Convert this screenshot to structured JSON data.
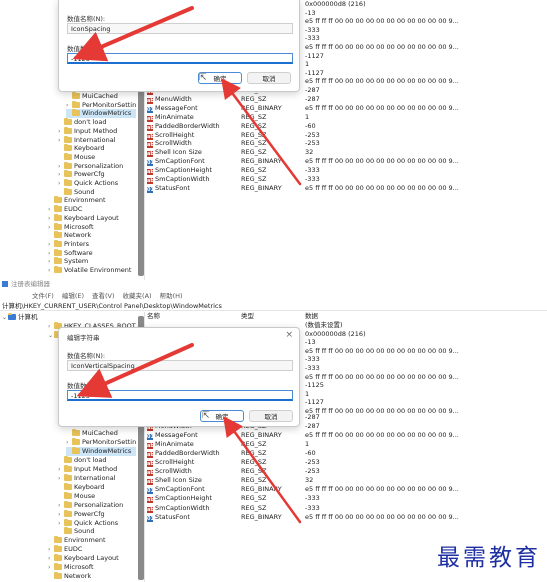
{
  "top": {
    "dialog": {
      "value_name_label": "数值名称(N):",
      "value_name": "IconSpacing",
      "value_data_label": "数值数据(V):",
      "value_data": "-1125",
      "ok": "确定",
      "cancel": "取消"
    },
    "tree": [
      {
        "label": "MuiCached",
        "indent": 1,
        "expand": ""
      },
      {
        "label": "PerMonitorSettin",
        "indent": 1,
        "expand": ">"
      },
      {
        "label": "WindowMetrics",
        "indent": 1,
        "expand": "",
        "selected": true
      },
      {
        "label": "don't load",
        "indent": 0,
        "expand": ""
      },
      {
        "label": "Input Method",
        "indent": 0,
        "expand": ">"
      },
      {
        "label": "International",
        "indent": 0,
        "expand": ">"
      },
      {
        "label": "Keyboard",
        "indent": 0,
        "expand": ""
      },
      {
        "label": "Mouse",
        "indent": 0,
        "expand": ""
      },
      {
        "label": "Personalization",
        "indent": 0,
        "expand": ">"
      },
      {
        "label": "PowerCfg",
        "indent": 0,
        "expand": ">"
      },
      {
        "label": "Quick Actions",
        "indent": 0,
        "expand": ">"
      },
      {
        "label": "Sound",
        "indent": 0,
        "expand": ""
      },
      {
        "label": "Environment",
        "indent": -1,
        "expand": ""
      },
      {
        "label": "EUDC",
        "indent": -1,
        "expand": ">"
      },
      {
        "label": "Keyboard Layout",
        "indent": -1,
        "expand": ">"
      },
      {
        "label": "Microsoft",
        "indent": -1,
        "expand": ">"
      },
      {
        "label": "Network",
        "indent": -1,
        "expand": ""
      },
      {
        "label": "Printers",
        "indent": -1,
        "expand": ">"
      },
      {
        "label": "Software",
        "indent": -1,
        "expand": ">"
      },
      {
        "label": "System",
        "indent": -1,
        "expand": ">"
      },
      {
        "label": "Volatile Environment",
        "indent": -1,
        "expand": ">"
      }
    ],
    "data_col_top": [
      "0x000000d8 (216)",
      "-13",
      "e5 ff ff ff 00 00 00 00 00 00 00 00 00 00 00 9...",
      "-333",
      "-333",
      "e5 ff ff ff 00 00 00 00 00 00 00 00 00 00 00 9...",
      "-1127",
      "1",
      "-1127",
      "e5 ff ff ff 00 00 00 00 00 00 00 00 00 00 00 9..."
    ],
    "rows": [
      {
        "name": "",
        "type": "REG_SZ",
        "data": "-287",
        "icon": "sz"
      },
      {
        "name": "MenuWidth",
        "type": "REG_SZ",
        "data": "-287",
        "icon": "sz"
      },
      {
        "name": "MessageFont",
        "type": "REG_BINARY",
        "data": "e5 ff ff ff 00 00 00 00 00 00 00 00 00 00 00 9...",
        "icon": "bin"
      },
      {
        "name": "MinAnimate",
        "type": "REG_SZ",
        "data": "1",
        "icon": "sz"
      },
      {
        "name": "PaddedBorderWidth",
        "type": "REG_SZ",
        "data": "-60",
        "icon": "sz"
      },
      {
        "name": "ScrollHeight",
        "type": "REG_SZ",
        "data": "-253",
        "icon": "sz"
      },
      {
        "name": "ScrollWidth",
        "type": "REG_SZ",
        "data": "-253",
        "icon": "sz"
      },
      {
        "name": "Shell Icon Size",
        "type": "REG_SZ",
        "data": "32",
        "icon": "sz"
      },
      {
        "name": "SmCaptionFont",
        "type": "REG_BINARY",
        "data": "e5 ff ff ff 00 00 00 00 00 00 00 00 00 00 00 9...",
        "icon": "bin"
      },
      {
        "name": "SmCaptionHeight",
        "type": "REG_SZ",
        "data": "-333",
        "icon": "sz"
      },
      {
        "name": "SmCaptionWidth",
        "type": "REG_SZ",
        "data": "-333",
        "icon": "sz"
      },
      {
        "name": "StatusFont",
        "type": "REG_BINARY",
        "data": "e5 ff ff ff 00 00 00 00 00 00 00 00 00 00 00 9...",
        "icon": "bin"
      }
    ]
  },
  "bottom": {
    "title": "注册表编辑器",
    "menu": [
      "文件(F)",
      "编辑(E)",
      "查看(V)",
      "收藏夹(A)",
      "帮助(H)"
    ],
    "address": "计算机\\HKEY_CURRENT_USER\\Control Panel\\Desktop\\WindowMetrics",
    "headers": {
      "name": "名称",
      "type": "类型",
      "data": "数据"
    },
    "tree_top": [
      {
        "label": "计算机",
        "indent": -2,
        "expand": "v"
      },
      {
        "label": "HKEY_CLASSES_ROOT",
        "indent": -1,
        "expand": ">"
      },
      {
        "label": "H",
        "indent": -1,
        "expand": "v"
      }
    ],
    "dialog": {
      "title": "编辑字符串",
      "close": "×",
      "value_name_label": "数值名称(N):",
      "value_name": "IconVerticalSpacing",
      "value_data_label": "数值数据(V):",
      "value_data": "-1125",
      "ok": "确定",
      "cancel": "取消"
    },
    "data_col_top": [
      "(数值未设置)",
      "0x000000d8 (216)",
      "-13",
      "e5 ff ff ff 00 00 00 00 00 00 00 00 00 00 00 9...",
      "-333",
      "-333",
      "e5 ff ff ff 00 00 00 00 00 00 00 00 00 00 00 9...",
      "-1125",
      "1",
      "-1127",
      "e5 ff ff ff 00 00 00 00 00 00 00 00 00 00 00 9..."
    ],
    "tree": [
      {
        "label": "MuiCached",
        "indent": 1,
        "expand": ""
      },
      {
        "label": "PerMonitorSettin",
        "indent": 1,
        "expand": ">"
      },
      {
        "label": "WindowMetrics",
        "indent": 1,
        "expand": "",
        "selected": true
      },
      {
        "label": "don't load",
        "indent": 0,
        "expand": ""
      },
      {
        "label": "Input Method",
        "indent": 0,
        "expand": ">"
      },
      {
        "label": "International",
        "indent": 0,
        "expand": ">"
      },
      {
        "label": "Keyboard",
        "indent": 0,
        "expand": ""
      },
      {
        "label": "Mouse",
        "indent": 0,
        "expand": ""
      },
      {
        "label": "Personalization",
        "indent": 0,
        "expand": ">"
      },
      {
        "label": "PowerCfg",
        "indent": 0,
        "expand": ">"
      },
      {
        "label": "Quick Actions",
        "indent": 0,
        "expand": ">"
      },
      {
        "label": "Sound",
        "indent": 0,
        "expand": ""
      },
      {
        "label": "Environment",
        "indent": -1,
        "expand": ""
      },
      {
        "label": "EUDC",
        "indent": -1,
        "expand": ">"
      },
      {
        "label": "Keyboard Layout",
        "indent": -1,
        "expand": ">"
      },
      {
        "label": "Microsoft",
        "indent": -1,
        "expand": ">"
      },
      {
        "label": "Network",
        "indent": -1,
        "expand": ""
      }
    ],
    "rows": [
      {
        "name": "",
        "type": "REG_SZ",
        "data": "-287",
        "icon": "sz"
      },
      {
        "name": "MenuWidth",
        "type": "REG_SZ",
        "data": "-287",
        "icon": "sz"
      },
      {
        "name": "MessageFont",
        "type": "REG_BINARY",
        "data": "e5 ff ff ff 00 00 00 00 00 00 00 00 00 00 00 9...",
        "icon": "bin"
      },
      {
        "name": "MinAnimate",
        "type": "REG_SZ",
        "data": "1",
        "icon": "sz"
      },
      {
        "name": "PaddedBorderWidth",
        "type": "REG_SZ",
        "data": "-60",
        "icon": "sz"
      },
      {
        "name": "ScrollHeight",
        "type": "REG_SZ",
        "data": "-253",
        "icon": "sz"
      },
      {
        "name": "ScrollWidth",
        "type": "REG_SZ",
        "data": "-253",
        "icon": "sz"
      },
      {
        "name": "Shell Icon Size",
        "type": "REG_SZ",
        "data": "32",
        "icon": "sz"
      },
      {
        "name": "SmCaptionFont",
        "type": "REG_BINARY",
        "data": "e5 ff ff ff 00 00 00 00 00 00 00 00 00 00 00 9...",
        "icon": "bin"
      },
      {
        "name": "SmCaptionHeight",
        "type": "REG_SZ",
        "data": "-333",
        "icon": "sz"
      },
      {
        "name": "SmCaptionWidth",
        "type": "REG_SZ",
        "data": "-333",
        "icon": "sz"
      },
      {
        "name": "StatusFont",
        "type": "REG_BINARY",
        "data": "e5 ff ff ff 00 00 00 00 00 00 00 00 00 00 00 9...",
        "icon": "bin"
      }
    ]
  },
  "watermark": "最需教育",
  "colors": {
    "arrow": "#e53935",
    "selected": "#cde6f7",
    "accent": "#1a6fd0"
  }
}
